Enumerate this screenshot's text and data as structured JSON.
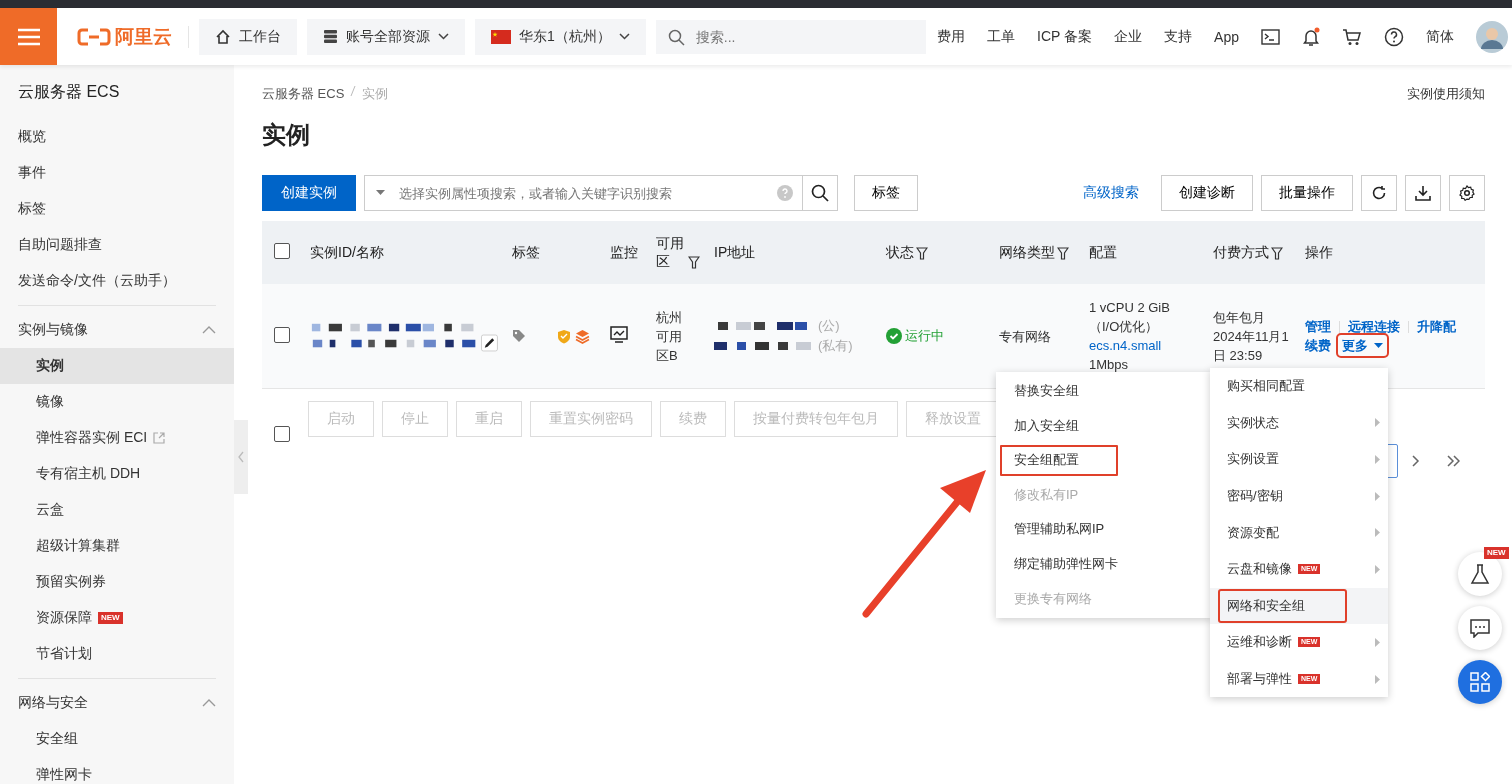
{
  "top_bar": {
    "logo": "阿里云",
    "nav": [
      {
        "kind": "home",
        "label": "工作台",
        "dropdown": false
      },
      {
        "kind": "resources",
        "label": "账号全部资源",
        "dropdown": true
      },
      {
        "kind": "region",
        "label": "华东1（杭州）",
        "dropdown": true
      }
    ],
    "search": {
      "placeholder": "搜索..."
    },
    "links": [
      "费用",
      "工单",
      "ICP 备案",
      "企业",
      "支持",
      "App"
    ],
    "bell_unread": true,
    "language": "简体"
  },
  "sidebar": {
    "title": "云服务器 ECS",
    "items": [
      {
        "label": "概览"
      },
      {
        "label": "事件"
      },
      {
        "label": "标签"
      },
      {
        "label": "自助问题排查"
      },
      {
        "label": "发送命令/文件（云助手）"
      }
    ],
    "groups": [
      {
        "title": "实例与镜像",
        "expanded": true,
        "items": [
          {
            "label": "实例",
            "selected": true
          },
          {
            "label": "镜像",
            "selected": false
          },
          {
            "label": "弹性容器实例 ECI",
            "selected": false,
            "external": true
          },
          {
            "label": "专有宿主机 DDH",
            "selected": false
          },
          {
            "label": "云盒",
            "selected": false
          },
          {
            "label": "超级计算集群",
            "selected": false
          },
          {
            "label": "预留实例券",
            "selected": false
          },
          {
            "label": "资源保障",
            "selected": false,
            "badge": "NEW"
          },
          {
            "label": "节省计划",
            "selected": false
          }
        ]
      },
      {
        "title": "网络与安全",
        "expanded": true,
        "items": [
          {
            "label": "安全组",
            "selected": false
          },
          {
            "label": "弹性网卡",
            "selected": false
          }
        ]
      }
    ]
  },
  "breadcrumb": [
    "云服务器 ECS",
    "实例"
  ],
  "notice_link": "实例使用须知",
  "title": "实例",
  "toolbar": {
    "create_button": "创建实例",
    "search_placeholder": "选择实例属性项搜索，或者输入关键字识别搜索",
    "tag_button": "标签",
    "advanced_search": "高级搜索",
    "buttons": [
      "创建诊断",
      "批量操作"
    ]
  },
  "table": {
    "select_all_checked": false,
    "columns": [
      {
        "label": "实例ID/名称",
        "filter": false
      },
      {
        "label": "标签",
        "filter": false
      },
      {
        "label": "监控",
        "filter": false
      },
      {
        "label": "可用区",
        "filter": true
      },
      {
        "label": "IP地址",
        "filter": false
      },
      {
        "label": "状态",
        "filter": true
      },
      {
        "label": "网络类型",
        "filter": true
      },
      {
        "label": "配置",
        "filter": false
      },
      {
        "label": "付费方式",
        "filter": true
      },
      {
        "label": "操作",
        "filter": false
      }
    ],
    "rows": [
      {
        "checked": false,
        "zone": "杭州可用区B",
        "public_ip_label": "(公)",
        "private_ip_label": "(私有)",
        "status": "运行中",
        "network": "专有网络",
        "config": [
          "1 vCPU 2 GiB",
          "（I/O优化）"
        ],
        "instance_type": "ecs.n4.small",
        "bandwidth": "1Mbps",
        "billing": "包年包月",
        "expiry": "2024年11月1日 23:59",
        "actions": [
          "管理",
          "远程连接",
          "升降配",
          "续费"
        ],
        "more": "更多"
      }
    ]
  },
  "batch_select_checked": false,
  "batch_actions": [
    {
      "label": "启动",
      "disabled": true
    },
    {
      "label": "停止",
      "disabled": true
    },
    {
      "label": "重启",
      "disabled": true
    },
    {
      "label": "重置实例密码",
      "disabled": true
    },
    {
      "label": "续费",
      "disabled": true
    },
    {
      "label": "按量付费转包年包月",
      "disabled": true
    },
    {
      "label": "释放设置",
      "disabled": true
    }
  ],
  "more_menu": [
    {
      "label": "购买相同配置",
      "submenu": false,
      "highlighted": false,
      "hovered": false
    },
    {
      "label": "实例状态",
      "submenu": true,
      "highlighted": false,
      "hovered": false
    },
    {
      "label": "实例设置",
      "submenu": true,
      "highlighted": false,
      "hovered": false
    },
    {
      "label": "密码/密钥",
      "submenu": true,
      "highlighted": false,
      "hovered": false
    },
    {
      "label": "资源变配",
      "submenu": true,
      "highlighted": false,
      "hovered": false
    },
    {
      "label": "云盘和镜像",
      "submenu": true,
      "badge": "NEW",
      "highlighted": false,
      "hovered": false
    },
    {
      "label": "网络和安全组",
      "submenu": false,
      "highlighted": true,
      "hovered": true
    },
    {
      "label": "运维和诊断",
      "submenu": true,
      "badge": "NEW",
      "highlighted": false,
      "hovered": false
    },
    {
      "label": "部署与弹性",
      "submenu": true,
      "badge": "NEW",
      "highlighted": false,
      "hovered": false
    }
  ],
  "sub_menu": [
    {
      "label": "替换安全组",
      "disabled": false,
      "highlighted": false
    },
    {
      "label": "加入安全组",
      "disabled": false,
      "highlighted": false
    },
    {
      "label": "安全组配置",
      "disabled": false,
      "highlighted": true
    },
    {
      "label": "修改私有IP",
      "disabled": true,
      "highlighted": false
    },
    {
      "label": "管理辅助私网IP",
      "disabled": false,
      "highlighted": false
    },
    {
      "label": "绑定辅助弹性网卡",
      "disabled": false,
      "highlighted": false
    },
    {
      "label": "更换专有网络",
      "disabled": true,
      "highlighted": false
    }
  ],
  "float_badge": "NEW"
}
